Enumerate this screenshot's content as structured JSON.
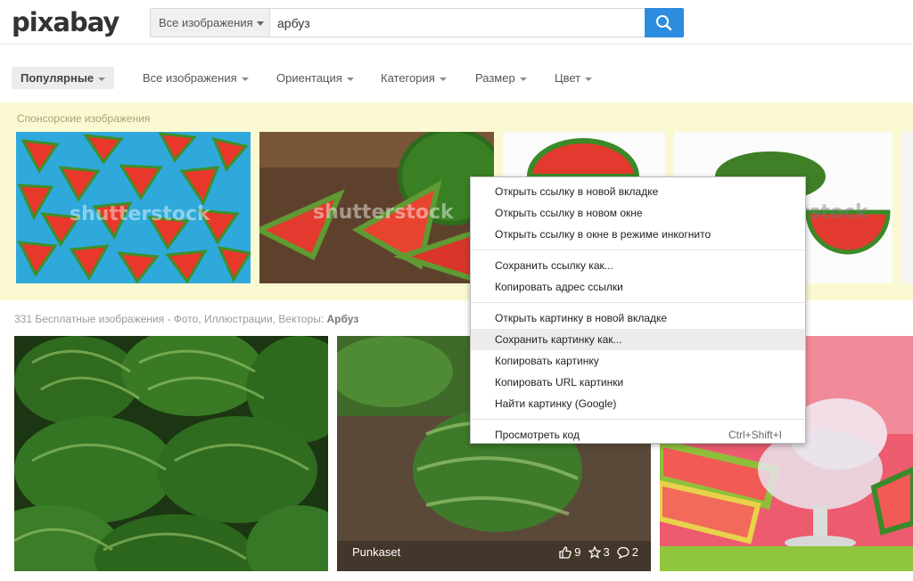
{
  "header": {
    "logo": "pixabay",
    "search_type": "Все изображения",
    "search_value": "арбуз"
  },
  "filters": [
    {
      "label": "Популярные"
    },
    {
      "label": "Все изображения"
    },
    {
      "label": "Ориентация"
    },
    {
      "label": "Категория"
    },
    {
      "label": "Размер"
    },
    {
      "label": "Цвет"
    }
  ],
  "sponsored": {
    "title": "Спонсорские изображения",
    "watermark": "shutterstock"
  },
  "results": {
    "title_prefix": "331 Бесплатные изображения - Фото, Иллюстрации, Векторы:",
    "title_query": "Арбуз"
  },
  "photos": [
    {
      "user": "",
      "likes": "",
      "favorites": "",
      "comments": ""
    },
    {
      "user": "Punkaset",
      "likes": "9",
      "favorites": "3",
      "comments": "2"
    },
    {
      "user": "",
      "likes": "",
      "favorites": "",
      "comments": ""
    }
  ],
  "context_menu": {
    "items": [
      {
        "label": "Открыть ссылку в новой вкладке"
      },
      {
        "label": "Открыть ссылку в новом окне"
      },
      {
        "label": "Открыть ссылку в окне в режиме инкогнито"
      },
      {
        "label": "Сохранить ссылку как..."
      },
      {
        "label": "Копировать адрес ссылки"
      },
      {
        "label": "Открыть картинку в новой вкладке"
      },
      {
        "label": "Сохранить картинку как..."
      },
      {
        "label": "Копировать картинку"
      },
      {
        "label": "Копировать URL картинки"
      },
      {
        "label": "Найти картинку (Google)"
      },
      {
        "label": "Просмотреть код",
        "shortcut": "Ctrl+Shift+I"
      }
    ]
  },
  "colors": {
    "accent": "#2b8ce0",
    "sponsored_bg": "#fbf9d2",
    "menu_highlight": "#ececec"
  }
}
